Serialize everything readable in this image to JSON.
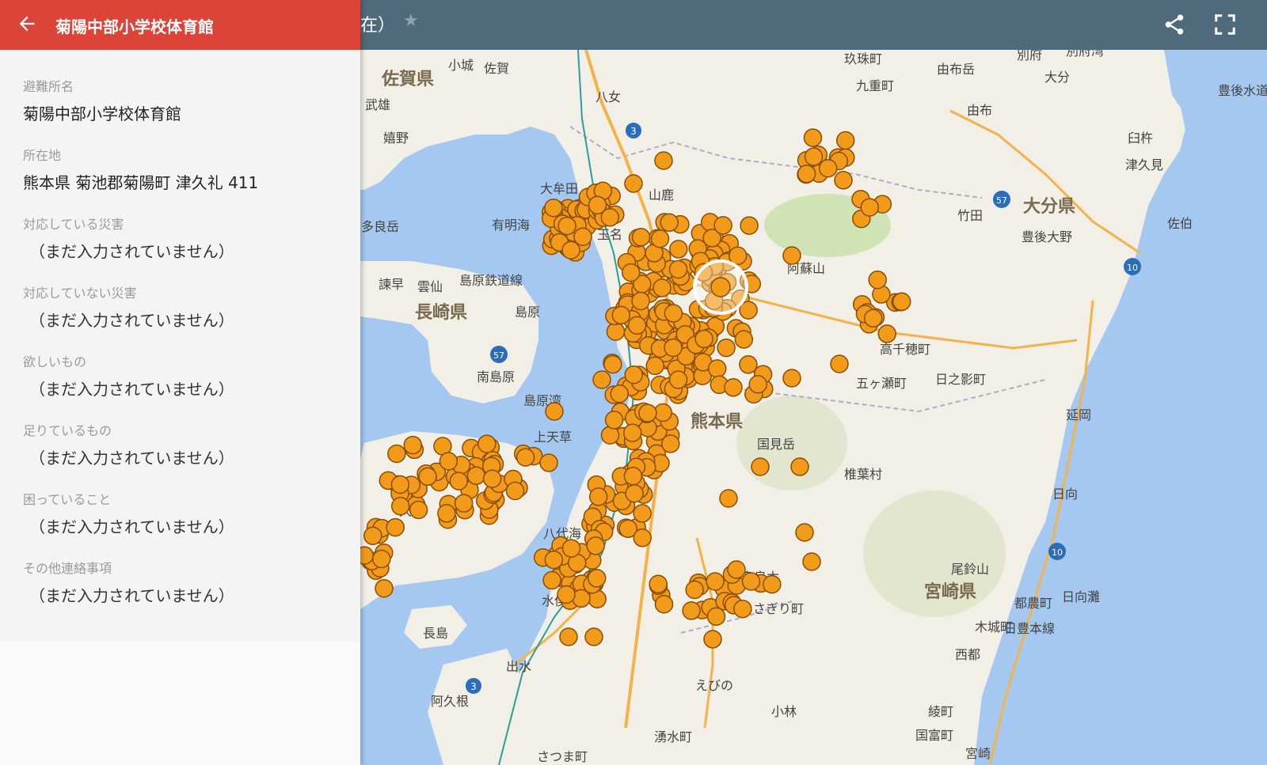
{
  "panel": {
    "title": "菊陽中部小学校体育館",
    "fields": [
      {
        "label": "避難所名",
        "value": "菊陽中部小学校体育館"
      },
      {
        "label": "所在地",
        "value": "熊本県 菊池郡菊陽町 津久礼 411"
      },
      {
        "label": "対応している災害",
        "value": "（まだ入力されていません）"
      },
      {
        "label": "対応していない災害",
        "value": "（まだ入力されていません）"
      },
      {
        "label": "欲しいもの",
        "value": "（まだ入力されていません）"
      },
      {
        "label": "足りているもの",
        "value": "（まだ入力されていません）"
      },
      {
        "label": "困っていること",
        "value": "（まだ入力されていません）"
      },
      {
        "label": "その他連絡事項",
        "value": "（まだ入力されていません）"
      }
    ]
  },
  "map_bar": {
    "title_fragment": "在）",
    "star_icon": "star-icon",
    "share_icon": "share-icon",
    "fullscreen_icon": "fullscreen-icon"
  },
  "map": {
    "prefectures": [
      "佐賀県",
      "長崎県",
      "熊本県",
      "大分県",
      "宮崎県"
    ],
    "places": [
      "小城",
      "佐賀",
      "武雄",
      "嬉野",
      "八女",
      "大牟田",
      "山鹿",
      "玉名",
      "雲仙",
      "諫早",
      "島原",
      "南島原",
      "上天草",
      "長島",
      "出水",
      "阿久根",
      "水俣",
      "えびの",
      "小林",
      "湧水町",
      "さつま町",
      "人吉",
      "あさぎり町",
      "多良木",
      "国見岳",
      "椎葉村",
      "日向",
      "尾鈴山",
      "都農町",
      "木城町",
      "西都",
      "綾町",
      "国富町",
      "宮崎",
      "延岡",
      "日之影町",
      "五ヶ瀬町",
      "高千穂町",
      "阿蘇山",
      "竹田",
      "豊後大野",
      "大分",
      "由布",
      "臼杵",
      "津久見",
      "佐伯",
      "別府",
      "玖珠町",
      "九重町",
      "由布岳",
      "別府湾",
      "日向灘",
      "豊後水道",
      "有明海",
      "島原湾",
      "八代海",
      "島原鉄道線",
      "日豊本線",
      "多良岳"
    ],
    "route_numbers": [
      "3",
      "57",
      "10"
    ],
    "marker_color": "#f29a1a",
    "marker_stroke": "#8a4d00",
    "selected_marker": "selected-location-marker"
  },
  "colors": {
    "panel_header": "#db4437",
    "map_bar": "#4f6a7a",
    "water": "#a4c8f0",
    "land": "#f2efe6"
  }
}
